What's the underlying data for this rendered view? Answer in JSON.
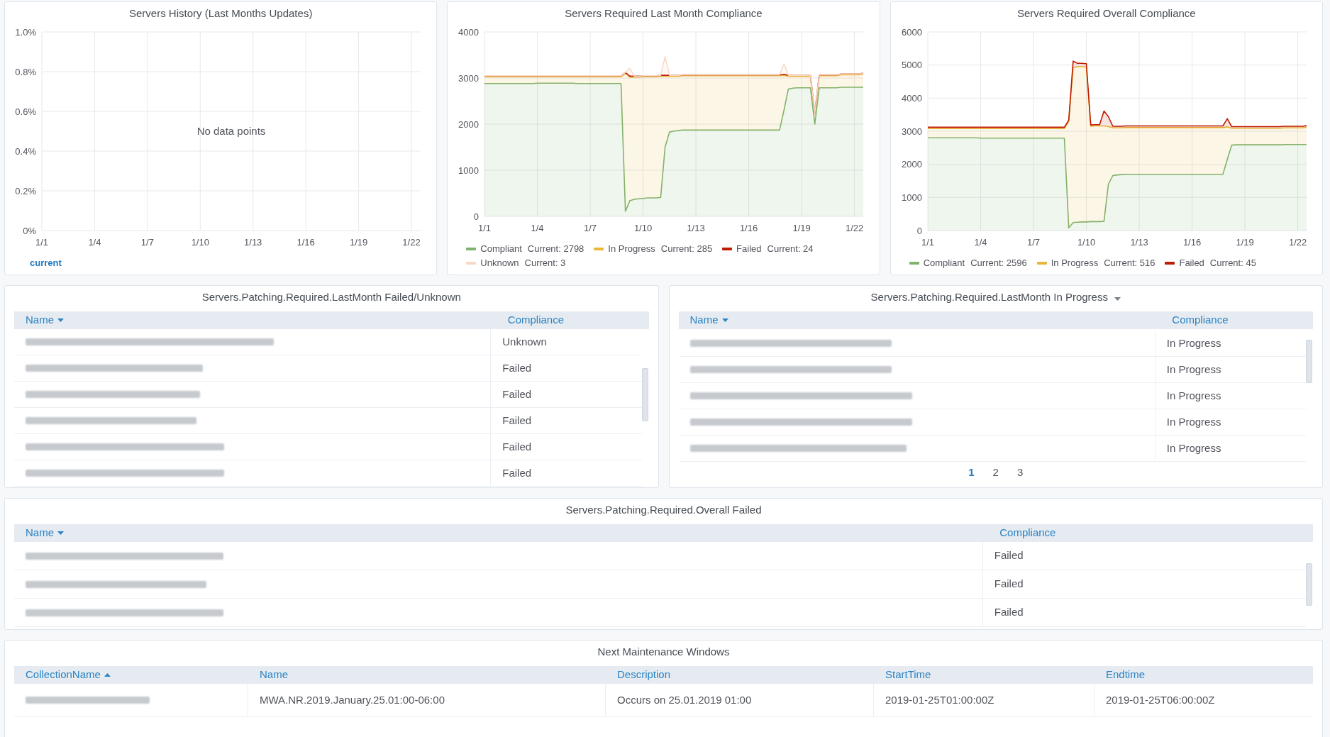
{
  "dashboard_rows": [
    {
      "panels": [
        {
          "kind": "graph",
          "title": "Servers History (Last Months Updates)",
          "title_menu": false,
          "chart_data": {
            "type": "line",
            "grid": true,
            "categories": [
              "1/1",
              "1/4",
              "1/7",
              "1/10",
              "1/13",
              "1/16",
              "1/19",
              "1/22"
            ],
            "ylim": [
              0,
              1
            ],
            "yticks": [
              {
                "value": 0,
                "label": "0%"
              },
              {
                "value": 0.2,
                "label": "0.2%"
              },
              {
                "value": 0.4,
                "label": "0.4%"
              },
              {
                "value": 0.6,
                "label": "0.6%"
              },
              {
                "value": 0.8,
                "label": "0.8%"
              },
              {
                "value": 1,
                "label": "1.0%"
              }
            ],
            "series": [
              {
                "name": "current",
                "color": "#1f78c1",
                "values": [
                  null,
                  null,
                  null,
                  null,
                  null,
                  null,
                  null,
                  null
                ]
              }
            ],
            "annotations": [
              {
                "text": "No data points"
              }
            ]
          }
        },
        {
          "kind": "graph",
          "title": "Servers Required Last Month Compliance",
          "title_menu": false,
          "chart_data": {
            "type": "area",
            "grid": true,
            "stacked": true,
            "ylim": [
              0,
              4000
            ],
            "yticks": [
              0,
              1000,
              2000,
              3000,
              4000
            ],
            "categories": [
              "1/1",
              null,
              null,
              null,
              null,
              null,
              null,
              null,
              null,
              null,
              null,
              null,
              "1/4",
              null,
              null,
              null,
              null,
              null,
              null,
              null,
              null,
              null,
              null,
              null,
              "1/7",
              null,
              null,
              null,
              null,
              null,
              null,
              null,
              null,
              null,
              null,
              null,
              "1/10",
              null,
              null,
              null,
              null,
              null,
              null,
              null,
              null,
              null,
              null,
              null,
              "1/13",
              null,
              null,
              null,
              null,
              null,
              null,
              null,
              null,
              null,
              null,
              null,
              "1/16",
              null,
              null,
              null,
              null,
              null,
              null,
              null,
              null,
              null,
              null,
              null,
              "1/19",
              null,
              null,
              null,
              null,
              null,
              null,
              null,
              null,
              null,
              null,
              null,
              "1/22",
              null,
              null
            ],
            "series": [
              {
                "name": "Compliant",
                "color": "#7eb26d",
                "values": [
                  2880,
                  2880,
                  2880,
                  2880,
                  2880,
                  2880,
                  2880,
                  2880,
                  2880,
                  2880,
                  2880,
                  2880,
                  2890,
                  2890,
                  2890,
                  2890,
                  2890,
                  2890,
                  2890,
                  2890,
                  2890,
                  2880,
                  2880,
                  2880,
                  2880,
                  2880,
                  2880,
                  2880,
                  2880,
                  2880,
                  2880,
                  2880,
                  110,
                  340,
                  370,
                  380,
                  390,
                  400,
                  400,
                  400,
                  410,
                  1500,
                  1830,
                  1850,
                  1860,
                  1870,
                  1870,
                  1870,
                  1870,
                  1870,
                  1870,
                  1870,
                  1870,
                  1870,
                  1870,
                  1870,
                  1870,
                  1870,
                  1870,
                  1870,
                  1870,
                  1870,
                  1870,
                  1870,
                  1870,
                  1870,
                  1870,
                  1870,
                  2300,
                  2760,
                  2780,
                  2790,
                  2790,
                  2790,
                  2790,
                  2000,
                  2790,
                  2790,
                  2790,
                  2790,
                  2790,
                  2800,
                  2800,
                  2800,
                  2800,
                  2800,
                  2800
                ]
              },
              {
                "name": "In Progress",
                "color": "#eab839",
                "values": [
                  150,
                  150,
                  150,
                  150,
                  150,
                  150,
                  150,
                  150,
                  150,
                  150,
                  150,
                  150,
                  140,
                  140,
                  140,
                  140,
                  140,
                  140,
                  140,
                  140,
                  140,
                  150,
                  150,
                  150,
                  150,
                  150,
                  150,
                  150,
                  150,
                  150,
                  150,
                  150,
                  2990,
                  2680,
                  2650,
                  2640,
                  2640,
                  2630,
                  2630,
                  2630,
                  2630,
                  1540,
                  1210,
                  1190,
                  1180,
                  1180,
                  1180,
                  1180,
                  1180,
                  1180,
                  1180,
                  1180,
                  1180,
                  1180,
                  1180,
                  1180,
                  1180,
                  1180,
                  1180,
                  1180,
                  1180,
                  1180,
                  1180,
                  1180,
                  1180,
                  1180,
                  1180,
                  1180,
                  760,
                  280,
                  260,
                  250,
                  250,
                  250,
                  250,
                  220,
                  260,
                  260,
                  260,
                  260,
                  260,
                  270,
                  270,
                  270,
                  270,
                  270,
                  290
                ]
              },
              {
                "name": "Failed",
                "color": "#bf1b00",
                "values": [
                  20,
                  20,
                  20,
                  20,
                  20,
                  20,
                  20,
                  20,
                  20,
                  20,
                  20,
                  20,
                  20,
                  20,
                  20,
                  20,
                  20,
                  20,
                  20,
                  20,
                  20,
                  20,
                  20,
                  20,
                  20,
                  20,
                  20,
                  20,
                  20,
                  20,
                  20,
                  20,
                  20,
                  20,
                  20,
                  20,
                  20,
                  20,
                  20,
                  20,
                  20,
                  20,
                  20,
                  20,
                  20,
                  20,
                  20,
                  20,
                  20,
                  20,
                  20,
                  20,
                  20,
                  20,
                  20,
                  20,
                  20,
                  20,
                  20,
                  20,
                  20,
                  20,
                  20,
                  20,
                  20,
                  20,
                  20,
                  20,
                  20,
                  20,
                  20,
                  20,
                  20,
                  20,
                  20,
                  20,
                  20,
                  20,
                  20,
                  20,
                  20,
                  20,
                  20,
                  20,
                  20,
                  20,
                  20
                ]
              },
              {
                "name": "Unknown",
                "color": "#f9d9c4",
                "values": [
                  0,
                  0,
                  0,
                  0,
                  0,
                  0,
                  0,
                  0,
                  0,
                  0,
                  0,
                  0,
                  0,
                  0,
                  0,
                  0,
                  0,
                  0,
                  0,
                  0,
                  0,
                  0,
                  0,
                  0,
                  0,
                  0,
                  0,
                  0,
                  0,
                  0,
                  0,
                  0,
                  0,
                  170,
                  0,
                  0,
                  0,
                  0,
                  0,
                  0,
                  0,
                  400,
                  0,
                  0,
                  0,
                  0,
                  0,
                  0,
                  0,
                  0,
                  0,
                  0,
                  0,
                  0,
                  0,
                  0,
                  0,
                  0,
                  0,
                  0,
                  0,
                  0,
                  0,
                  0,
                  0,
                  0,
                  0,
                  0,
                  220,
                  0,
                  0,
                  0,
                  0,
                  0,
                  0,
                  0,
                  0,
                  0,
                  0,
                  0,
                  0,
                  0,
                  0,
                  0,
                  0,
                  0,
                  0
                ]
              }
            ]
          },
          "legend_readings": [
            "Current: 2798",
            "Current: 285",
            "Current: 24",
            "Current: 3"
          ]
        },
        {
          "kind": "graph",
          "title": "Servers Required Overall Compliance",
          "title_menu": false,
          "chart_data": {
            "type": "area",
            "grid": true,
            "stacked": true,
            "ylim": [
              0,
              6000
            ],
            "yticks": [
              0,
              1000,
              2000,
              3000,
              4000,
              5000,
              6000
            ],
            "categories": [
              "1/1",
              null,
              null,
              null,
              null,
              null,
              null,
              null,
              null,
              null,
              null,
              null,
              "1/4",
              null,
              null,
              null,
              null,
              null,
              null,
              null,
              null,
              null,
              null,
              null,
              "1/7",
              null,
              null,
              null,
              null,
              null,
              null,
              null,
              null,
              null,
              null,
              null,
              "1/10",
              null,
              null,
              null,
              null,
              null,
              null,
              null,
              null,
              null,
              null,
              null,
              "1/13",
              null,
              null,
              null,
              null,
              null,
              null,
              null,
              null,
              null,
              null,
              null,
              "1/16",
              null,
              null,
              null,
              null,
              null,
              null,
              null,
              null,
              null,
              null,
              null,
              "1/19",
              null,
              null,
              null,
              null,
              null,
              null,
              null,
              null,
              null,
              null,
              null,
              "1/22",
              null,
              null
            ],
            "series": [
              {
                "name": "Compliant",
                "color": "#7eb26d",
                "values": [
                  2800,
                  2800,
                  2800,
                  2800,
                  2800,
                  2800,
                  2800,
                  2800,
                  2800,
                  2800,
                  2800,
                  2800,
                  2790,
                  2790,
                  2790,
                  2790,
                  2790,
                  2790,
                  2790,
                  2790,
                  2790,
                  2790,
                  2790,
                  2790,
                  2790,
                  2790,
                  2790,
                  2790,
                  2790,
                  2790,
                  2790,
                  2790,
                  80,
                  240,
                  250,
                  260,
                  260,
                  270,
                  270,
                  270,
                  280,
                  1400,
                  1660,
                  1680,
                  1690,
                  1700,
                  1700,
                  1700,
                  1700,
                  1700,
                  1700,
                  1700,
                  1700,
                  1700,
                  1700,
                  1700,
                  1700,
                  1700,
                  1700,
                  1700,
                  1700,
                  1700,
                  1700,
                  1700,
                  1700,
                  1700,
                  1700,
                  1700,
                  2150,
                  2580,
                  2590,
                  2590,
                  2590,
                  2590,
                  2590,
                  2590,
                  2590,
                  2590,
                  2590,
                  2590,
                  2590,
                  2600,
                  2600,
                  2600,
                  2600,
                  2600,
                  2600
                ]
              },
              {
                "name": "In Progress",
                "color": "#eab839",
                "values": [
                  280,
                  280,
                  280,
                  280,
                  280,
                  280,
                  280,
                  280,
                  280,
                  280,
                  280,
                  280,
                  290,
                  290,
                  290,
                  290,
                  290,
                  290,
                  290,
                  290,
                  290,
                  290,
                  290,
                  290,
                  290,
                  290,
                  290,
                  290,
                  290,
                  290,
                  290,
                  290,
                  3220,
                  4680,
                  4700,
                  4690,
                  4680,
                  2880,
                  2890,
                  2890,
                  2880,
                  1740,
                  1440,
                  1420,
                  1410,
                  1410,
                  1410,
                  1410,
                  1410,
                  1410,
                  1410,
                  1410,
                  1410,
                  1410,
                  1410,
                  1410,
                  1410,
                  1410,
                  1410,
                  1410,
                  1410,
                  1410,
                  1410,
                  1410,
                  1410,
                  1410,
                  1410,
                  1410,
                  980,
                  510,
                  500,
                  500,
                  500,
                  500,
                  500,
                  500,
                  500,
                  500,
                  500,
                  500,
                  500,
                  500,
                  500,
                  500,
                  500,
                  500,
                  520
                ]
              },
              {
                "name": "Failed",
                "color": "#bf1b00",
                "values": [
                  40,
                  40,
                  40,
                  40,
                  40,
                  40,
                  40,
                  40,
                  40,
                  40,
                  40,
                  40,
                  40,
                  40,
                  40,
                  40,
                  40,
                  40,
                  40,
                  40,
                  40,
                  40,
                  40,
                  40,
                  40,
                  40,
                  40,
                  40,
                  40,
                  40,
                  40,
                  40,
                  40,
                  200,
                  100,
                  100,
                  100,
                  40,
                  40,
                  40,
                  450,
                  300,
                  50,
                  50,
                  50,
                  50,
                  50,
                  50,
                  50,
                  50,
                  50,
                  50,
                  50,
                  50,
                  50,
                  50,
                  50,
                  50,
                  50,
                  50,
                  50,
                  50,
                  50,
                  50,
                  50,
                  50,
                  50,
                  50,
                  250,
                  50,
                  50,
                  50,
                  50,
                  50,
                  50,
                  50,
                  50,
                  50,
                  50,
                  50,
                  50,
                  50,
                  50,
                  50,
                  50,
                  50,
                  50
                ]
              }
            ]
          },
          "legend_readings": [
            "Current: 2596",
            "Current: 516",
            "Current: 45"
          ]
        }
      ]
    },
    {
      "panels": [
        {
          "kind": "table",
          "title": "Servers.Patching.Required.LastMonth Failed/Unknown",
          "title_menu": false,
          "scrollbar": true,
          "columns": [
            {
              "label": "Name",
              "sorted_descending": true,
              "sorted_ascending": false
            },
            {
              "label": "Compliance",
              "sorted_descending": false,
              "sorted_ascending": false
            }
          ],
          "rows": [
            {
              "cells": [
                {
                  "blurred": true
                },
                {
                  "blurred": false,
                  "text": "Unknown"
                }
              ]
            },
            {
              "cells": [
                {
                  "blurred": true
                },
                {
                  "blurred": false,
                  "text": "Failed"
                }
              ]
            },
            {
              "cells": [
                {
                  "blurred": true
                },
                {
                  "blurred": false,
                  "text": "Failed"
                }
              ]
            },
            {
              "cells": [
                {
                  "blurred": true
                },
                {
                  "blurred": false,
                  "text": "Failed"
                }
              ]
            },
            {
              "cells": [
                {
                  "blurred": true
                },
                {
                  "blurred": false,
                  "text": "Failed"
                }
              ]
            },
            {
              "cells": [
                {
                  "blurred": true
                },
                {
                  "blurred": false,
                  "text": "Failed"
                }
              ]
            }
          ]
        },
        {
          "kind": "table",
          "title": "Servers.Patching.Required.LastMonth In Progress",
          "title_menu": true,
          "scrollbar": true,
          "columns": [
            {
              "label": "Name",
              "sorted_descending": true,
              "sorted_ascending": false
            },
            {
              "label": "Compliance",
              "sorted_descending": false,
              "sorted_ascending": false
            }
          ],
          "rows": [
            {
              "cells": [
                {
                  "blurred": true
                },
                {
                  "blurred": false,
                  "text": "In Progress"
                }
              ]
            },
            {
              "cells": [
                {
                  "blurred": true
                },
                {
                  "blurred": false,
                  "text": "In Progress"
                }
              ]
            },
            {
              "cells": [
                {
                  "blurred": true
                },
                {
                  "blurred": false,
                  "text": "In Progress"
                }
              ]
            },
            {
              "cells": [
                {
                  "blurred": true
                },
                {
                  "blurred": false,
                  "text": "In Progress"
                }
              ]
            },
            {
              "cells": [
                {
                  "blurred": true
                },
                {
                  "blurred": false,
                  "text": "In Progress"
                }
              ]
            }
          ],
          "pagination": [
            {
              "label": "1",
              "selected": true
            },
            {
              "label": "2",
              "selected": false
            },
            {
              "label": "3",
              "selected": false
            }
          ]
        }
      ]
    },
    {
      "panels": [
        {
          "kind": "table",
          "title": "Servers.Patching.Required.Overall Failed",
          "title_menu": false,
          "scrollbar": true,
          "columns": [
            {
              "label": "Name",
              "sorted_descending": true,
              "sorted_ascending": false
            },
            {
              "label": "Compliance",
              "sorted_descending": false,
              "sorted_ascending": false
            }
          ],
          "rows": [
            {
              "cells": [
                {
                  "blurred": true
                },
                {
                  "blurred": false,
                  "text": "Failed"
                }
              ]
            },
            {
              "cells": [
                {
                  "blurred": true
                },
                {
                  "blurred": false,
                  "text": "Failed"
                }
              ]
            },
            {
              "cells": [
                {
                  "blurred": true
                },
                {
                  "blurred": false,
                  "text": "Failed"
                }
              ]
            }
          ]
        }
      ]
    },
    {
      "panels": [
        {
          "kind": "table",
          "title": "Next Maintenance Windows",
          "title_menu": false,
          "scrollbar": false,
          "columns": [
            {
              "label": "CollectionName",
              "sorted_descending": false,
              "sorted_ascending": true
            },
            {
              "label": "Name",
              "sorted_descending": false,
              "sorted_ascending": false
            },
            {
              "label": "Description",
              "sorted_descending": false,
              "sorted_ascending": false
            },
            {
              "label": "StartTime",
              "sorted_descending": false,
              "sorted_ascending": false
            },
            {
              "label": "Endtime",
              "sorted_descending": false,
              "sorted_ascending": false
            }
          ],
          "rows": [
            {
              "cells": [
                {
                  "blurred": true
                },
                {
                  "blurred": false,
                  "text": "MWA.NR.2019.January.25.01:00-06:00"
                },
                {
                  "blurred": false,
                  "text": "Occurs on 25.01.2019 01:00"
                },
                {
                  "blurred": false,
                  "text": "2019-01-25T01:00:00Z"
                },
                {
                  "blurred": false,
                  "text": "2019-01-25T06:00:00Z"
                }
              ]
            }
          ]
        }
      ]
    }
  ]
}
